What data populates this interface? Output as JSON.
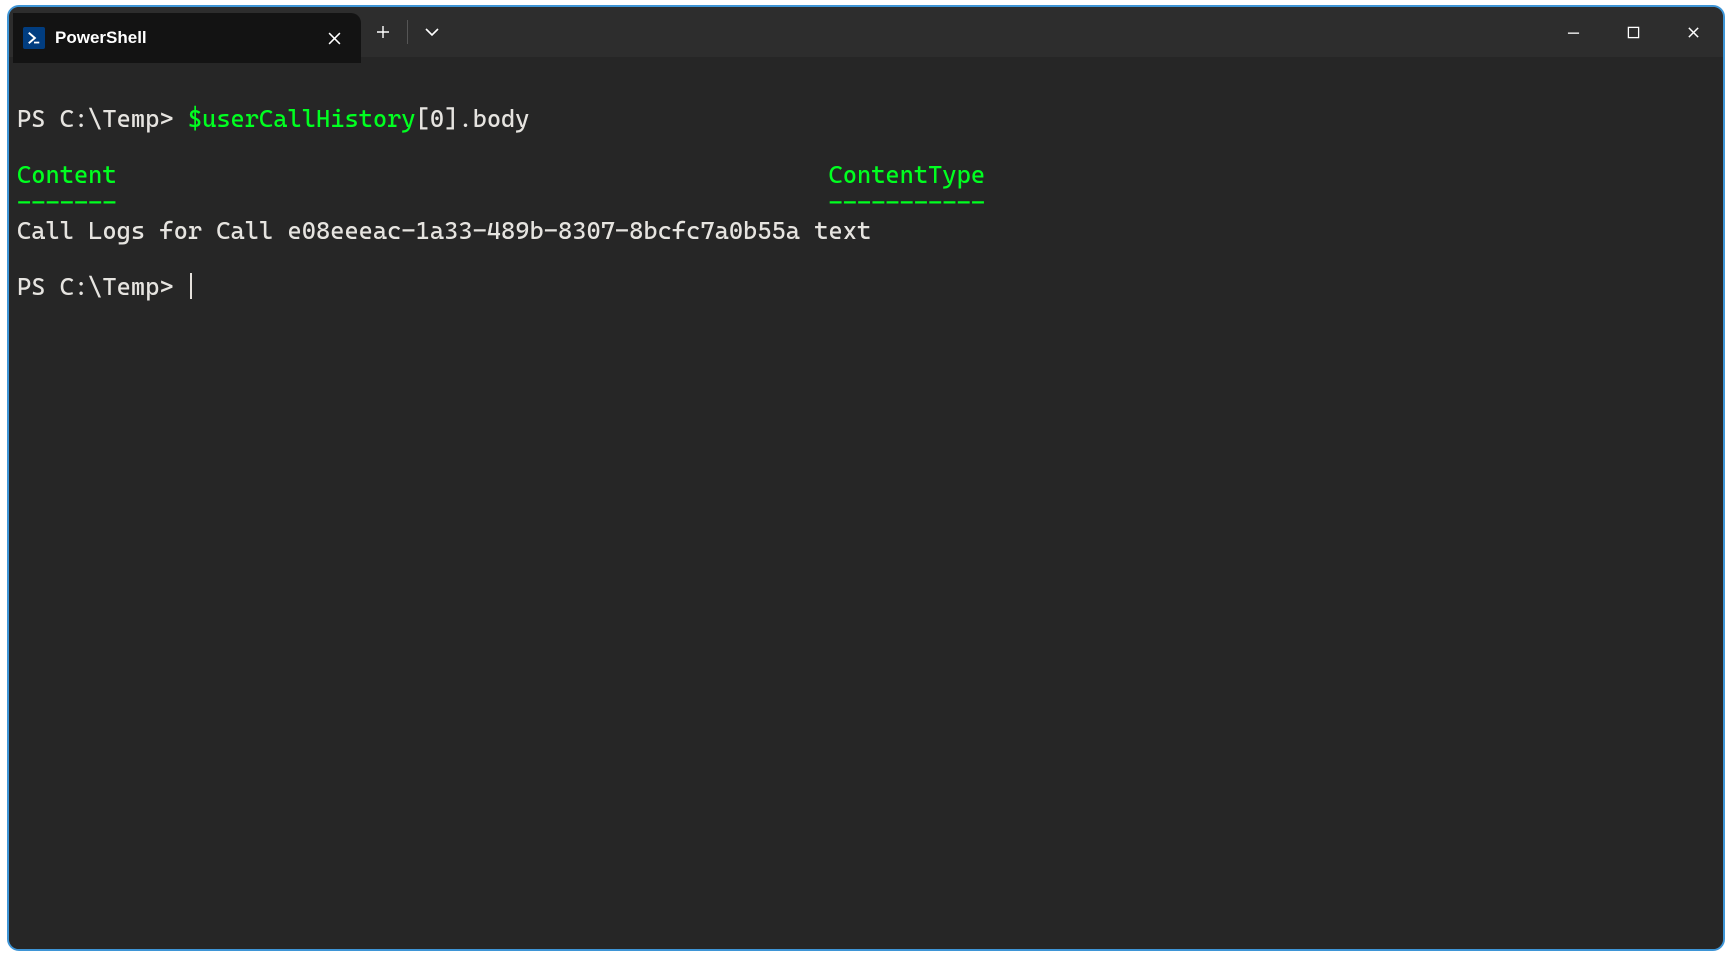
{
  "window": {
    "tab_title": "PowerShell"
  },
  "colors": {
    "window_border": "#3e95d6",
    "titlebar_bg": "#2d2d2d",
    "tab_bg": "#131313",
    "term_bg": "#262626",
    "fg": "#e5e1dc",
    "accent_green": "#00ff20",
    "ps_icon_bg": "#013d80"
  },
  "term": {
    "prompt_prefix": "PS C:\\Temp> ",
    "cmd_var": "$userCallHistory",
    "cmd_index": "[0].body",
    "columns": {
      "col1_header": "Content",
      "col1_underline": "-------",
      "col2_header": "ContentType",
      "col2_underline": "-----------"
    },
    "row": {
      "content": "Call Logs for Call e08eeeac-1a33-489b-8307-8bcfc7a0b55a",
      "contenttype": "text"
    },
    "prompt2": "PS C:\\Temp> "
  }
}
